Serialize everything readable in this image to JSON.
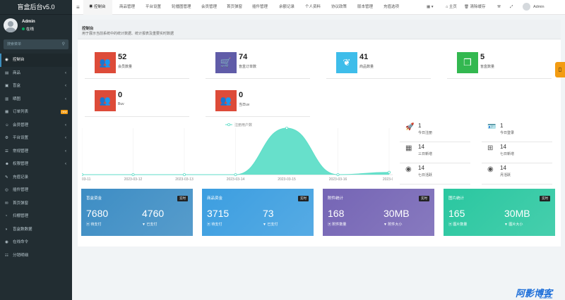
{
  "brand": "盲盒后台v5.0",
  "user": {
    "name": "Admin",
    "status": "在线"
  },
  "search": {
    "placeholder": "搜索菜单"
  },
  "sidebar": {
    "items": [
      {
        "icon": "◉",
        "label": "控制台",
        "arrow": ""
      },
      {
        "icon": "▤",
        "label": "商品",
        "arrow": "‹"
      },
      {
        "icon": "▣",
        "label": "盲盒",
        "arrow": "‹"
      },
      {
        "icon": "▥",
        "label": "晒图",
        "arrow": "‹"
      },
      {
        "icon": "▦",
        "label": "订单列表",
        "arrow": "",
        "badge": "new"
      },
      {
        "icon": "☺",
        "label": "会员管理",
        "arrow": "‹"
      },
      {
        "icon": "⚙",
        "label": "平台设置",
        "arrow": "‹"
      },
      {
        "icon": "☰",
        "label": "常规管理",
        "arrow": "‹"
      },
      {
        "icon": "☻",
        "label": "权限管理",
        "arrow": "‹"
      },
      {
        "icon": "✎",
        "label": "充值记录",
        "arrow": ""
      },
      {
        "icon": "◎",
        "label": "插件管理",
        "arrow": ""
      },
      {
        "icon": "✉",
        "label": "首页弹窗",
        "arrow": ""
      },
      {
        "icon": "◔",
        "label": "扫棚管理",
        "arrow": ""
      },
      {
        "icon": "◑",
        "label": "盲盒数数据",
        "arrow": ""
      },
      {
        "icon": "◉",
        "label": "在线命令",
        "arrow": ""
      },
      {
        "icon": "☷",
        "label": "分销明细",
        "arrow": ""
      }
    ]
  },
  "topbar": {
    "menu_icon": "≡",
    "tabs": [
      "控制台",
      "商品管理",
      "平台设置",
      "轮播图管理",
      "会员管理",
      "首页弹窗",
      "插件管理",
      "余额记录",
      "个人资料",
      "协议政策",
      "版本管理",
      "充值选项"
    ],
    "right": {
      "grid": "▦ ▾",
      "home": "主页",
      "clear": "清除缓存",
      "tools": "⚒",
      "fullscreen": "⤢",
      "admin": "Admin"
    }
  },
  "header": {
    "title": "控制台",
    "subtitle": "用于展示当前系统中的统计数据、统计报表及重要实时数据"
  },
  "stats": [
    {
      "value": "52",
      "label": "会员数量",
      "color": "#dd4b39",
      "icon": "users-icon"
    },
    {
      "value": "74",
      "label": "盲盒订单数",
      "color": "#605ca8",
      "icon": "cart-icon"
    },
    {
      "value": "41",
      "label": "商品数量",
      "color": "#3ebdea",
      "icon": "leaf-icon"
    },
    {
      "value": "5",
      "label": "盲盒数量",
      "color": "#33b850",
      "icon": "box-icon"
    },
    {
      "value": "0",
      "label": "Buv",
      "color": "#dd4b39",
      "icon": "users-icon"
    },
    {
      "value": "0",
      "label": "当日uv",
      "color": "#dd4b39",
      "icon": "users-icon"
    }
  ],
  "chart_data": {
    "type": "area",
    "title": "",
    "legend": "注册用户数",
    "x": [
      "03-11",
      "2023-03-12",
      "2023-03-13",
      "2023-03-14",
      "2023-03-15",
      "2023-03-16",
      "2023-03"
    ],
    "series": [
      {
        "name": "注册用户数",
        "values": [
          0,
          0,
          0,
          0,
          1,
          0,
          0.05
        ]
      }
    ],
    "color": "#5fdec8",
    "grid": true
  },
  "mini_stats": [
    {
      "value": "1",
      "label": "今日注册",
      "icon": "rocket-icon"
    },
    {
      "value": "1",
      "label": "今日登录",
      "icon": "id-card-icon"
    },
    {
      "value": "14",
      "label": "三日新增",
      "icon": "calendar-icon"
    },
    {
      "value": "14",
      "label": "七日新增",
      "icon": "calendar-plus-icon"
    },
    {
      "value": "14",
      "label": "七日活跃",
      "icon": "user-circle-icon"
    },
    {
      "value": "14",
      "label": "月活跃",
      "icon": "user-circle-icon"
    }
  ],
  "cards": [
    {
      "title": "盲盒资金",
      "badge": "实时",
      "v1": "7680",
      "l1": "待支付",
      "v2": "4760",
      "l2": "已支付",
      "color": "#3d8dc4"
    },
    {
      "title": "商品资金",
      "badge": "实时",
      "v1": "3715",
      "l1": "待支付",
      "v2": "73",
      "l2": "已支付",
      "color": "#3c9ee0"
    },
    {
      "title": "附件统计",
      "badge": "实时",
      "v1": "168",
      "l1": "附件数量",
      "v2": "30MB",
      "l2": "附件大小",
      "color": "#7565b5"
    },
    {
      "title": "图片统计",
      "badge": "实时",
      "v1": "165",
      "l1": "图片数量",
      "v2": "30MB",
      "l2": "图片大小",
      "color": "#2ac7a0"
    }
  ],
  "watermark": {
    "text": "阿影博客",
    "sub": "AYBK.CN"
  }
}
